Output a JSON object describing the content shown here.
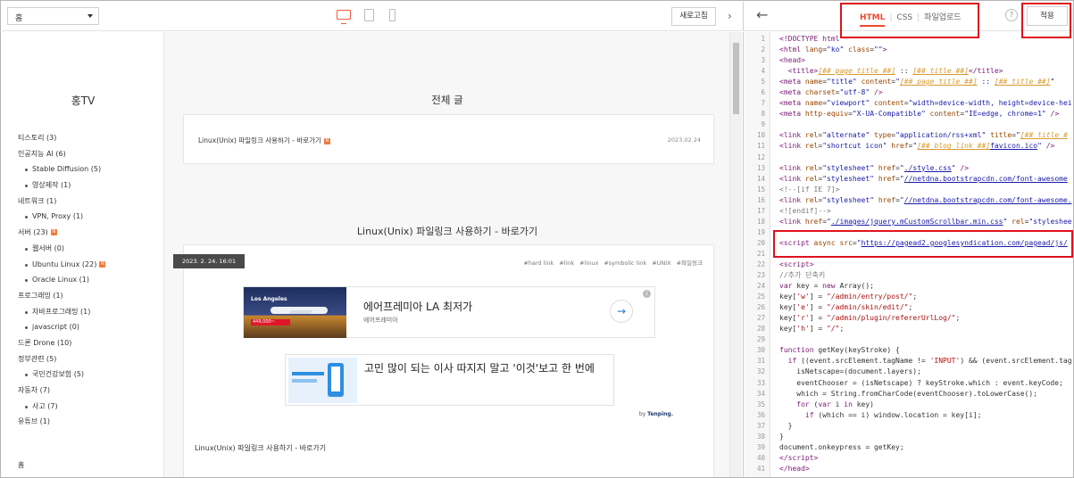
{
  "toolbar": {
    "page_select": "홈",
    "refresh_label": "새로고침",
    "collapse_glyph": "›"
  },
  "sidebar": {
    "blog_name": "홍TV",
    "categories": [
      {
        "label": "티스토리 (3)",
        "sub": false,
        "new": false
      },
      {
        "label": "인공지능 AI (6)",
        "sub": false,
        "new": false
      },
      {
        "label": "Stable Diffusion (5)",
        "sub": true,
        "new": false
      },
      {
        "label": "영상제작 (1)",
        "sub": true,
        "new": false
      },
      {
        "label": "네트워크 (1)",
        "sub": false,
        "new": false
      },
      {
        "label": "VPN, Proxy (1)",
        "sub": true,
        "new": false
      },
      {
        "label": "서버 (23)",
        "sub": false,
        "new": true
      },
      {
        "label": "웹서버 (0)",
        "sub": true,
        "new": false
      },
      {
        "label": "Ubuntu Linux (22)",
        "sub": true,
        "new": true
      },
      {
        "label": "Oracle Linux (1)",
        "sub": true,
        "new": false
      },
      {
        "label": "프로그래밍 (1)",
        "sub": false,
        "new": false
      },
      {
        "label": "자바프로그래밍 (1)",
        "sub": true,
        "new": false
      },
      {
        "label": "javascript (0)",
        "sub": true,
        "new": false
      },
      {
        "label": "드론 Drone (10)",
        "sub": false,
        "new": false
      },
      {
        "label": "정부관련 (5)",
        "sub": false,
        "new": false
      },
      {
        "label": "국민건강보험 (5)",
        "sub": true,
        "new": false
      },
      {
        "label": "자동차 (7)",
        "sub": false,
        "new": false
      },
      {
        "label": "사고 (7)",
        "sub": true,
        "new": false
      },
      {
        "label": "유튜브 (1)",
        "sub": false,
        "new": false
      }
    ],
    "home_label": "홈",
    "new_badge": "N"
  },
  "content": {
    "list_heading": "전체 글",
    "list_item_title": "Linux(Unix) 파일링크 사용하기 - 바로가기",
    "list_item_date": "2023.02.24",
    "post_heading": "Linux(Unix) 파일링크 사용하기 - 바로가기",
    "post_datetime": "2023. 2. 24. 16:01",
    "tags": [
      "#hard link",
      "#link",
      "#linux",
      "#symbolic link",
      "#UNIX",
      "#파일링크"
    ],
    "ad1": {
      "title": "에어프레미아 LA 최저가",
      "advertiser": "에어프레미아",
      "image_text": "Los Angeles",
      "image_price": "449,000~",
      "go_glyph": "→",
      "info_glyph": "i"
    },
    "ad2": {
      "title": "고민 많이 되는 이사 따지지 말고 '이것'보고 한 번에"
    },
    "byline_prefix": "by",
    "byline_brand": "Tenping.",
    "post_title": "Linux(Unix) 파일링크 사용하기 - 바로가기"
  },
  "editor": {
    "back_glyph": "←",
    "tabs": [
      "HTML",
      "CSS",
      "파일업로드"
    ],
    "help_label": "?",
    "apply_label": "적용",
    "lines": [
      {
        "no": "1",
        "html": "<span class=\"k\">&lt;!DOCTYPE html</span>"
      },
      {
        "no": "2",
        "html": "<span class=\"k\">&lt;html</span> <span class=\"a\">lang</span>=<span class=\"s\">\"ko\"</span> <span class=\"a\">class</span>=<span class=\"s\">\"\"</span><span class=\"k\">&gt;</span>"
      },
      {
        "no": "3",
        "html": "<span class=\"k\">&lt;head&gt;</span>"
      },
      {
        "no": "4",
        "html": "  <span class=\"k\">&lt;title&gt;</span><span class=\"tv\">[##_page_title_##]</span> :: <span class=\"tv\">[##_title_##]</span><span class=\"k\">&lt;/title&gt;</span>"
      },
      {
        "no": "5",
        "html": "<span class=\"k\">&lt;meta</span> <span class=\"a\">name</span>=<span class=\"s\">\"title\"</span> <span class=\"a\">content</span>=<span class=\"s\">\"</span><span class=\"tv\">[##_page_title_##]</span><span class=\"s\"> :: </span><span class=\"tv\">[##_title_##]</span><span class=\"s\">\"</span>"
      },
      {
        "no": "6",
        "html": "<span class=\"k\">&lt;meta</span> <span class=\"a\">charset</span>=<span class=\"s\">\"utf-8\"</span> <span class=\"k\">/&gt;</span>"
      },
      {
        "no": "7",
        "html": "<span class=\"k\">&lt;meta</span> <span class=\"a\">name</span>=<span class=\"s\">\"viewport\"</span> <span class=\"a\">content</span>=<span class=\"s\">\"width=device-width, height=device-hei</span>"
      },
      {
        "no": "8",
        "html": "<span class=\"k\">&lt;meta</span> <span class=\"a\">http-equiv</span>=<span class=\"s\">\"X-UA-Compatible\"</span> <span class=\"a\">content</span>=<span class=\"s\">\"IE=edge, chrome=1\"</span> <span class=\"k\">/&gt;</span>"
      },
      {
        "no": "9",
        "html": ""
      },
      {
        "no": "10",
        "html": "<span class=\"k\">&lt;link</span> <span class=\"a\">rel</span>=<span class=\"s\">\"alternate\"</span> <span class=\"a\">type</span>=<span class=\"s\">\"application/rss+xml\"</span> <span class=\"a\">title</span>=<span class=\"s\">\"</span><span class=\"tv\">[##_title_#</span>"
      },
      {
        "no": "11",
        "html": "<span class=\"k\">&lt;link</span> <span class=\"a\">rel</span>=<span class=\"s\">\"shortcut icon\"</span> <span class=\"a\">href</span>=<span class=\"s\">\"</span><span class=\"tv\">[##_blog_link_##]</span><span class=\"u\">favicon.ico</span><span class=\"s\">\"</span> <span class=\"k\">/&gt;</span>"
      },
      {
        "no": "12",
        "html": ""
      },
      {
        "no": "13",
        "html": "<span class=\"k\">&lt;link</span> <span class=\"a\">rel</span>=<span class=\"s\">\"stylesheet\"</span> <span class=\"a\">href</span>=<span class=\"s\">\"</span><span class=\"u\">./style.css</span><span class=\"s\">\"</span> <span class=\"k\">/&gt;</span>"
      },
      {
        "no": "14",
        "html": "<span class=\"k\">&lt;link</span> <span class=\"a\">rel</span>=<span class=\"s\">\"stylesheet\"</span> <span class=\"a\">href</span>=<span class=\"s\">\"</span><span class=\"u\">//netdna.bootstrapcdn.com/font-awesome</span>"
      },
      {
        "no": "15",
        "html": "<span class=\"cm\">&lt;!--[if IE 7]&gt;</span>"
      },
      {
        "no": "16",
        "html": "<span class=\"k\">&lt;link</span> <span class=\"a\">rel</span>=<span class=\"s\">\"stylesheet\"</span> <span class=\"a\">href</span>=<span class=\"s\">\"</span><span class=\"u\">//netdna.bootstrapcdn.com/font-awesome.</span>"
      },
      {
        "no": "17",
        "html": "<span class=\"cm\">&lt;![endif]--&gt;</span>"
      },
      {
        "no": "18",
        "html": "<span class=\"k\">&lt;link</span> <span class=\"a\">href</span>=<span class=\"s\">\"</span><span class=\"u\">./images/jquery.mCustomScrollbar.min.css</span><span class=\"s\">\"</span> <span class=\"a\">rel</span>=<span class=\"s\">\"styleshee</span>"
      },
      {
        "no": "19",
        "html": ""
      },
      {
        "no": "20",
        "html": "<span class=\"k\">&lt;script</span> <span class=\"a\">async</span> <span class=\"a\">src</span>=<span class=\"s\">\"</span><span class=\"u\">https://pagead2.googlesyndication.com/pagead/js/</span>"
      },
      {
        "no": "21",
        "html": ""
      },
      {
        "no": "22",
        "html": "<span class=\"k\">&lt;script&gt;</span>"
      },
      {
        "no": "23",
        "html": "<span class=\"cm\">//추가 단축키</span>"
      },
      {
        "no": "24",
        "html": "<span class=\"kw\">var</span> key = <span class=\"kw\">new</span> Array();"
      },
      {
        "no": "25",
        "html": "key[<span class=\"str\">'w'</span>] = <span class=\"str\">\"/admin/entry/post/\"</span>;"
      },
      {
        "no": "26",
        "html": "key[<span class=\"str\">'e'</span>] = <span class=\"str\">\"/admin/skin/edit/\"</span>;"
      },
      {
        "no": "27",
        "html": "key[<span class=\"str\">'r'</span>] = <span class=\"str\">\"/admin/plugin/refererUrlLog/\"</span>;"
      },
      {
        "no": "28",
        "html": "key[<span class=\"str\">'h'</span>] = <span class=\"str\">\"/\"</span>;"
      },
      {
        "no": "29",
        "html": ""
      },
      {
        "no": "30",
        "html": "<span class=\"kw\">function</span> getKey(keyStroke) {"
      },
      {
        "no": "31",
        "html": "  <span class=\"kw\">if</span> ((event.srcElement.tagName != <span class=\"str\">'INPUT'</span>) &amp;&amp; (event.srcElement.tag"
      },
      {
        "no": "32",
        "html": "    isNetscape=(document.layers);"
      },
      {
        "no": "33",
        "html": "    eventChooser = (isNetscape) ? keyStroke.which : event.keyCode;"
      },
      {
        "no": "34",
        "html": "    which = String.fromCharCode(eventChooser).toLowerCase();"
      },
      {
        "no": "35",
        "html": "    <span class=\"kw\">for</span> (<span class=\"kw\">var</span> i <span class=\"kw\">in</span> key)"
      },
      {
        "no": "36",
        "html": "      <span class=\"kw\">if</span> (which == i) window.location = key[i];"
      },
      {
        "no": "37",
        "html": "  }"
      },
      {
        "no": "38",
        "html": "}"
      },
      {
        "no": "39",
        "html": "document.onkeypress = getKey;"
      },
      {
        "no": "40",
        "html": "<span class=\"k\">&lt;/script&gt;</span>"
      },
      {
        "no": "41",
        "html": "<span class=\"k\">&lt;/head&gt;</span>"
      }
    ]
  },
  "colors": {
    "accent": "#ee4a2a",
    "highlight_box": "#e0111e",
    "new_badge": "#f07a3c"
  }
}
